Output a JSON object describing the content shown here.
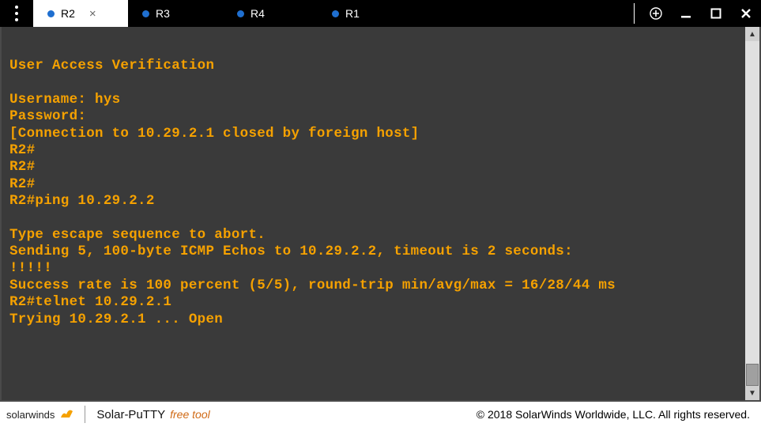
{
  "tabs": [
    {
      "label": "R2",
      "active": true,
      "closeable": true
    },
    {
      "label": "R3",
      "active": false,
      "closeable": false
    },
    {
      "label": "R4",
      "active": false,
      "closeable": false
    },
    {
      "label": "R1",
      "active": false,
      "closeable": false
    }
  ],
  "terminal_lines": [
    "",
    "User Access Verification",
    "",
    "Username: hys",
    "Password:",
    "[Connection to 10.29.2.1 closed by foreign host]",
    "R2#",
    "R2#",
    "R2#",
    "R2#ping 10.29.2.2",
    "",
    "Type escape sequence to abort.",
    "Sending 5, 100-byte ICMP Echos to 10.29.2.2, timeout is 2 seconds:",
    "!!!!!",
    "Success rate is 100 percent (5/5), round-trip min/avg/max = 16/28/44 ms",
    "R2#telnet 10.29.2.1",
    "Trying 10.29.2.1 ... Open"
  ],
  "footer": {
    "brand": "solarwinds",
    "product": "Solar-PuTTY",
    "tagline": "free tool",
    "copyright": "© 2018 SolarWinds Worldwide, LLC. All rights reserved."
  },
  "colors": {
    "term_bg": "#3a3a3a",
    "term_text": "#f5a100",
    "tab_dot": "#1f6fd0"
  }
}
